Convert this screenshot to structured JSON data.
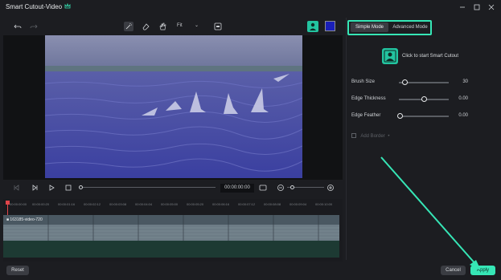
{
  "window": {
    "title": "Smart Cutout-Video"
  },
  "toolbar": {
    "fit_label": "Fit"
  },
  "player": {
    "timecode": "00:00:00:00"
  },
  "timeline": {
    "ruler_labels": [
      "00:00:00:00",
      "00:00:00:20",
      "00:00:01:16",
      "00:00:02:12",
      "00:00:03:08",
      "00:00:04:04",
      "00:00:05:00",
      "00:00:05:20",
      "00:00:06:16",
      "00:00:07:12",
      "00:00:08:08",
      "00:00:09:04",
      "00:00:10:00"
    ],
    "clip_name": "163185-video-720"
  },
  "panel": {
    "mode_simple": "Simple Mode",
    "mode_advanced": "Advanced Mode",
    "cutout_prompt": "Click to start Smart Cutout",
    "brush_size_label": "Brush Size",
    "brush_size_value": "30",
    "edge_thickness_label": "Edge Thickness",
    "edge_thickness_value": "0.00",
    "edge_feather_label": "Edge Feather",
    "edge_feather_value": "0.00",
    "add_border_label": "Add Border"
  },
  "footer": {
    "reset_label": "Reset",
    "cancel_label": "Cancel",
    "apply_label": "Apply"
  },
  "colors": {
    "accent": "#36e6b6",
    "background": "#1c1d21"
  }
}
